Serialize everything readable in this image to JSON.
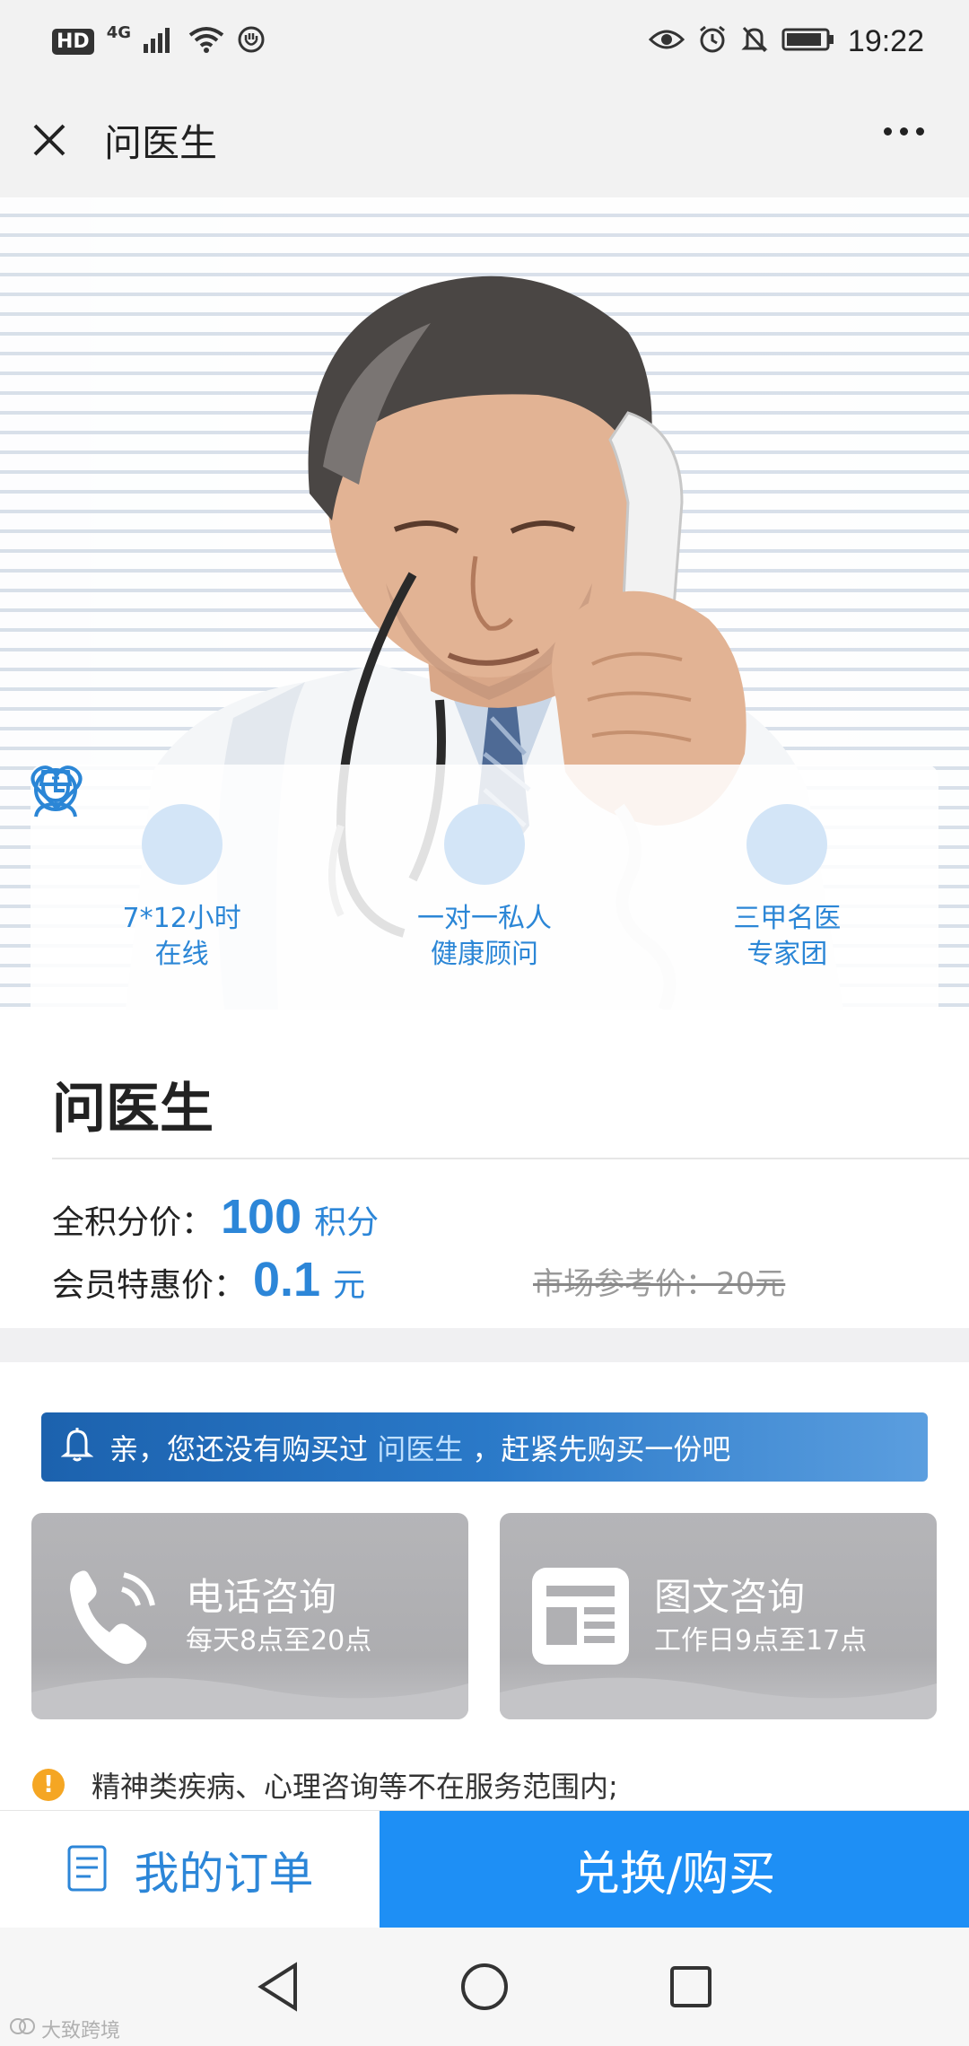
{
  "status_bar": {
    "hd": "HD",
    "network": "4G",
    "time": "19:22",
    "icons": [
      "signal-icon",
      "wifi-icon",
      "shield-icon",
      "eye-icon",
      "alarm-icon",
      "mute-icon",
      "battery-icon"
    ]
  },
  "nav": {
    "title": "问医生",
    "close_icon": "close-icon",
    "more_icon": "more-icon"
  },
  "hero": {
    "features": [
      {
        "icon": "clock-icon",
        "line1": "7*12小时",
        "line2": "在线"
      },
      {
        "icon": "heart-icon",
        "line1": "一对一私人",
        "line2": "健康顾问"
      },
      {
        "icon": "doctor-icon",
        "line1": "三甲名医",
        "line2": "专家团"
      }
    ]
  },
  "product": {
    "name": "问医生",
    "points_label": "全积分价：",
    "points_value": "100",
    "points_unit": "积分",
    "member_label": "会员特惠价：",
    "member_value": "0.1",
    "member_unit": "元",
    "market_price": "市场参考价：20元"
  },
  "notice": {
    "prefix": "亲，您还没有购买过",
    "link": "问医生",
    "suffix": "，赶紧先购买一份吧"
  },
  "consult": {
    "phone": {
      "title": "电话咨询",
      "hours": "每天8点至20点"
    },
    "text": {
      "title": "图文咨询",
      "hours": "工作日9点至17点"
    }
  },
  "disclaimer": "精神类疾病、心理咨询等不在服务范围内;",
  "actions": {
    "orders": "我的订单",
    "buy": "兑换/购买"
  },
  "watermark": "大致跨境",
  "colors": {
    "accent": "#2c86d8",
    "buy_button": "#1e8ff5",
    "notice_bg": "#1c62ae",
    "card_gray": "#b0b0b3",
    "warning": "#f5a623"
  }
}
